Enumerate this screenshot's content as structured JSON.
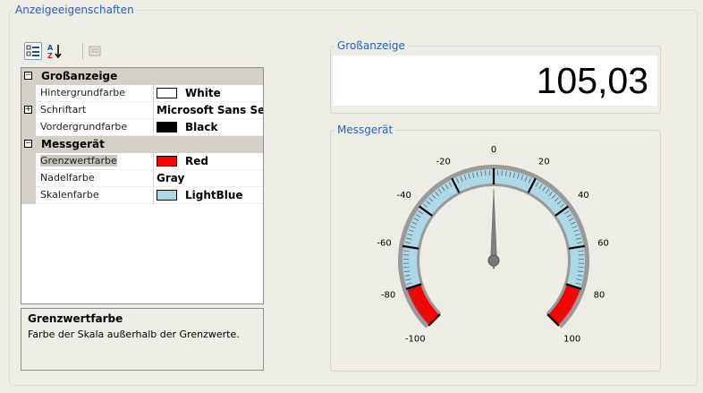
{
  "main": {
    "legend": "Anzeigeeigenschaften"
  },
  "toolbar": {
    "categorized_icon": "categorized-view-icon",
    "alphabetical_icon": "alphabetical-sort-icon",
    "property_pages_icon": "property-pages-icon"
  },
  "property_grid": {
    "categories": [
      {
        "name": "Großanzeige",
        "rows": [
          {
            "name": "Hintergrundfarbe",
            "value": "White",
            "swatch": "#ffffff"
          },
          {
            "name": "Schriftart",
            "value": "Microsoft Sans Serif;",
            "expandable": true
          },
          {
            "name": "Vordergrundfarbe",
            "value": "Black",
            "swatch": "#000000"
          }
        ]
      },
      {
        "name": "Messgerät",
        "rows": [
          {
            "name": "Grenzwertfarbe",
            "value": "Red",
            "swatch": "#ff0000",
            "selected": true
          },
          {
            "name": "Nadelfarbe",
            "value": "Gray"
          },
          {
            "name": "Skalenfarbe",
            "value": "LightBlue",
            "swatch": "#add8e6"
          }
        ]
      }
    ],
    "description": {
      "title": "Grenzwertfarbe",
      "text": "Farbe der Skala außerhalb der Grenzwerte."
    }
  },
  "big_display": {
    "legend": "Großanzeige",
    "value": "105,03"
  },
  "gauge": {
    "legend": "Messgerät",
    "min": -100,
    "max": 100,
    "needle_value": 0,
    "low_limit": -80,
    "high_limit": 80,
    "scale_color": "#add8e6",
    "limit_color": "#ff0000",
    "needle_color": "#808080",
    "major_labels": [
      "-100",
      "-80",
      "-60",
      "-40",
      "-20",
      "0",
      "20",
      "40",
      "60",
      "80",
      "100"
    ],
    "major_values": [
      -100,
      -80,
      -60,
      -40,
      -20,
      0,
      20,
      40,
      60,
      80,
      100
    ]
  }
}
